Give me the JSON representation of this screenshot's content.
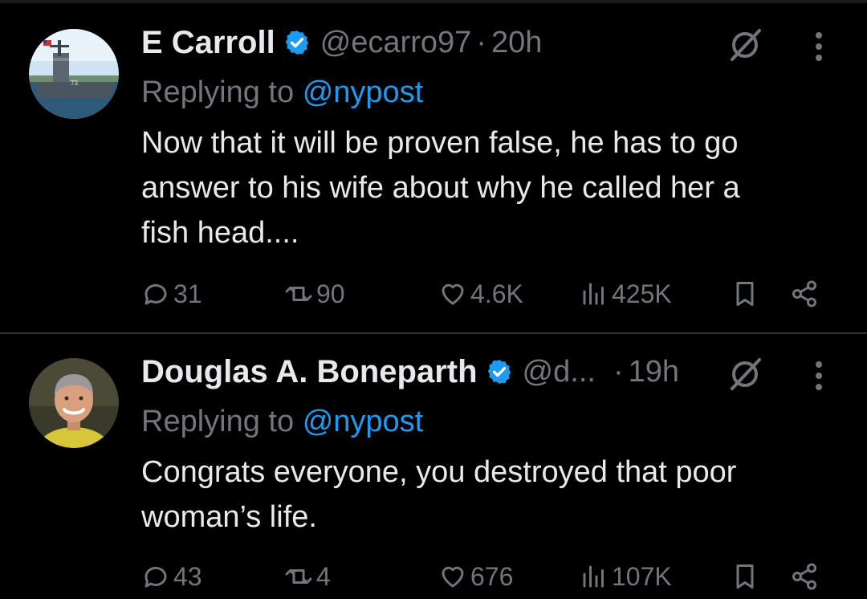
{
  "colors": {
    "background": "#000000",
    "text": "#e7e9ea",
    "muted": "#71767b",
    "accent": "#1d9bf0",
    "divider": "#2f3336"
  },
  "tweets": [
    {
      "name": "E Carroll",
      "verified_icon": "verified-badge-icon",
      "handle": "@ecarro97",
      "separator": "·",
      "time": "20h",
      "replying_prefix": "Replying to",
      "replying_to": "@nypost",
      "body_lines": [
        "Now that it will be proven false, he has to go",
        "answer to his wife about why he called her a",
        "fish head...."
      ],
      "actions": {
        "replies": "31",
        "retweets": "90",
        "likes": "4.6K",
        "views": "425K"
      }
    },
    {
      "name": "Douglas A. Boneparth",
      "verified_icon": "verified-badge-icon",
      "handle": "@d...",
      "separator": "·",
      "time": "19h",
      "replying_prefix": "Replying to",
      "replying_to": "@nypost",
      "body_lines": [
        "Congrats everyone, you destroyed that poor",
        "woman’s life."
      ],
      "actions": {
        "replies": "43",
        "retweets": "4",
        "likes": "676",
        "views": "107K"
      }
    }
  ]
}
